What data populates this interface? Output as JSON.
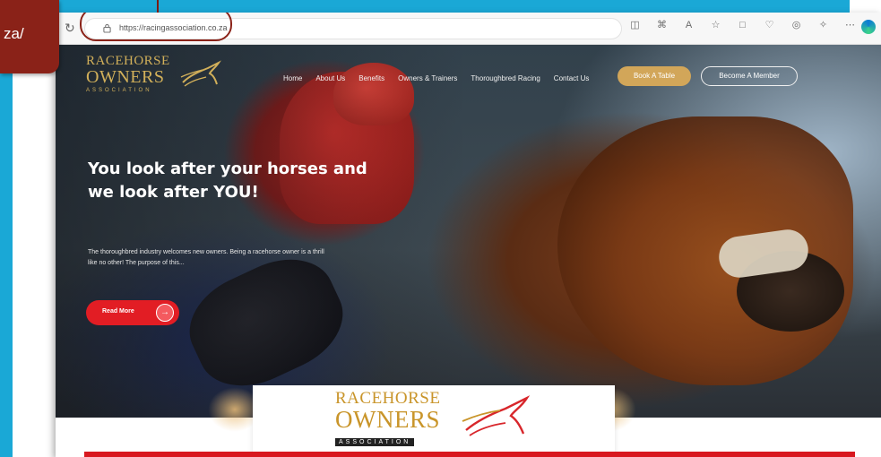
{
  "callout": {
    "text": "za/"
  },
  "browser": {
    "url": "https://racingassociation.co.za",
    "toolbar_icons": [
      "split-screen-icon",
      "extensions-icon",
      "read-aloud-icon",
      "favorite-icon",
      "collections-icon",
      "favorites-bar-icon",
      "browser-essentials-icon",
      "copilot-icon",
      "more-icon"
    ]
  },
  "site": {
    "logo": {
      "line1": "RACEHORSE",
      "line2": "OWNERS",
      "line3": "ASSOCIATION"
    },
    "nav": [
      "Home",
      "About Us",
      "Benefits",
      "Owners & Trainers",
      "Thoroughbred Racing",
      "Contact Us"
    ],
    "book_button": "Book A Table",
    "member_button": "Become A Member",
    "hero": {
      "heading": "You look after your horses and we look after YOU!",
      "blurb": "The thoroughbred industry welcomes new owners. Being a racehorse owner is a thrill like no other! The purpose of this...",
      "read_more": "Read More"
    },
    "footer_logo": {
      "line1": "RACEHORSE",
      "line2": "OWNERS",
      "line3": "ASSOCIATION"
    }
  },
  "colors": {
    "frame_blue": "#1aa8d6",
    "callout_red": "#8a2218",
    "gold": "#d2a659",
    "cta_red": "#e21d24"
  }
}
